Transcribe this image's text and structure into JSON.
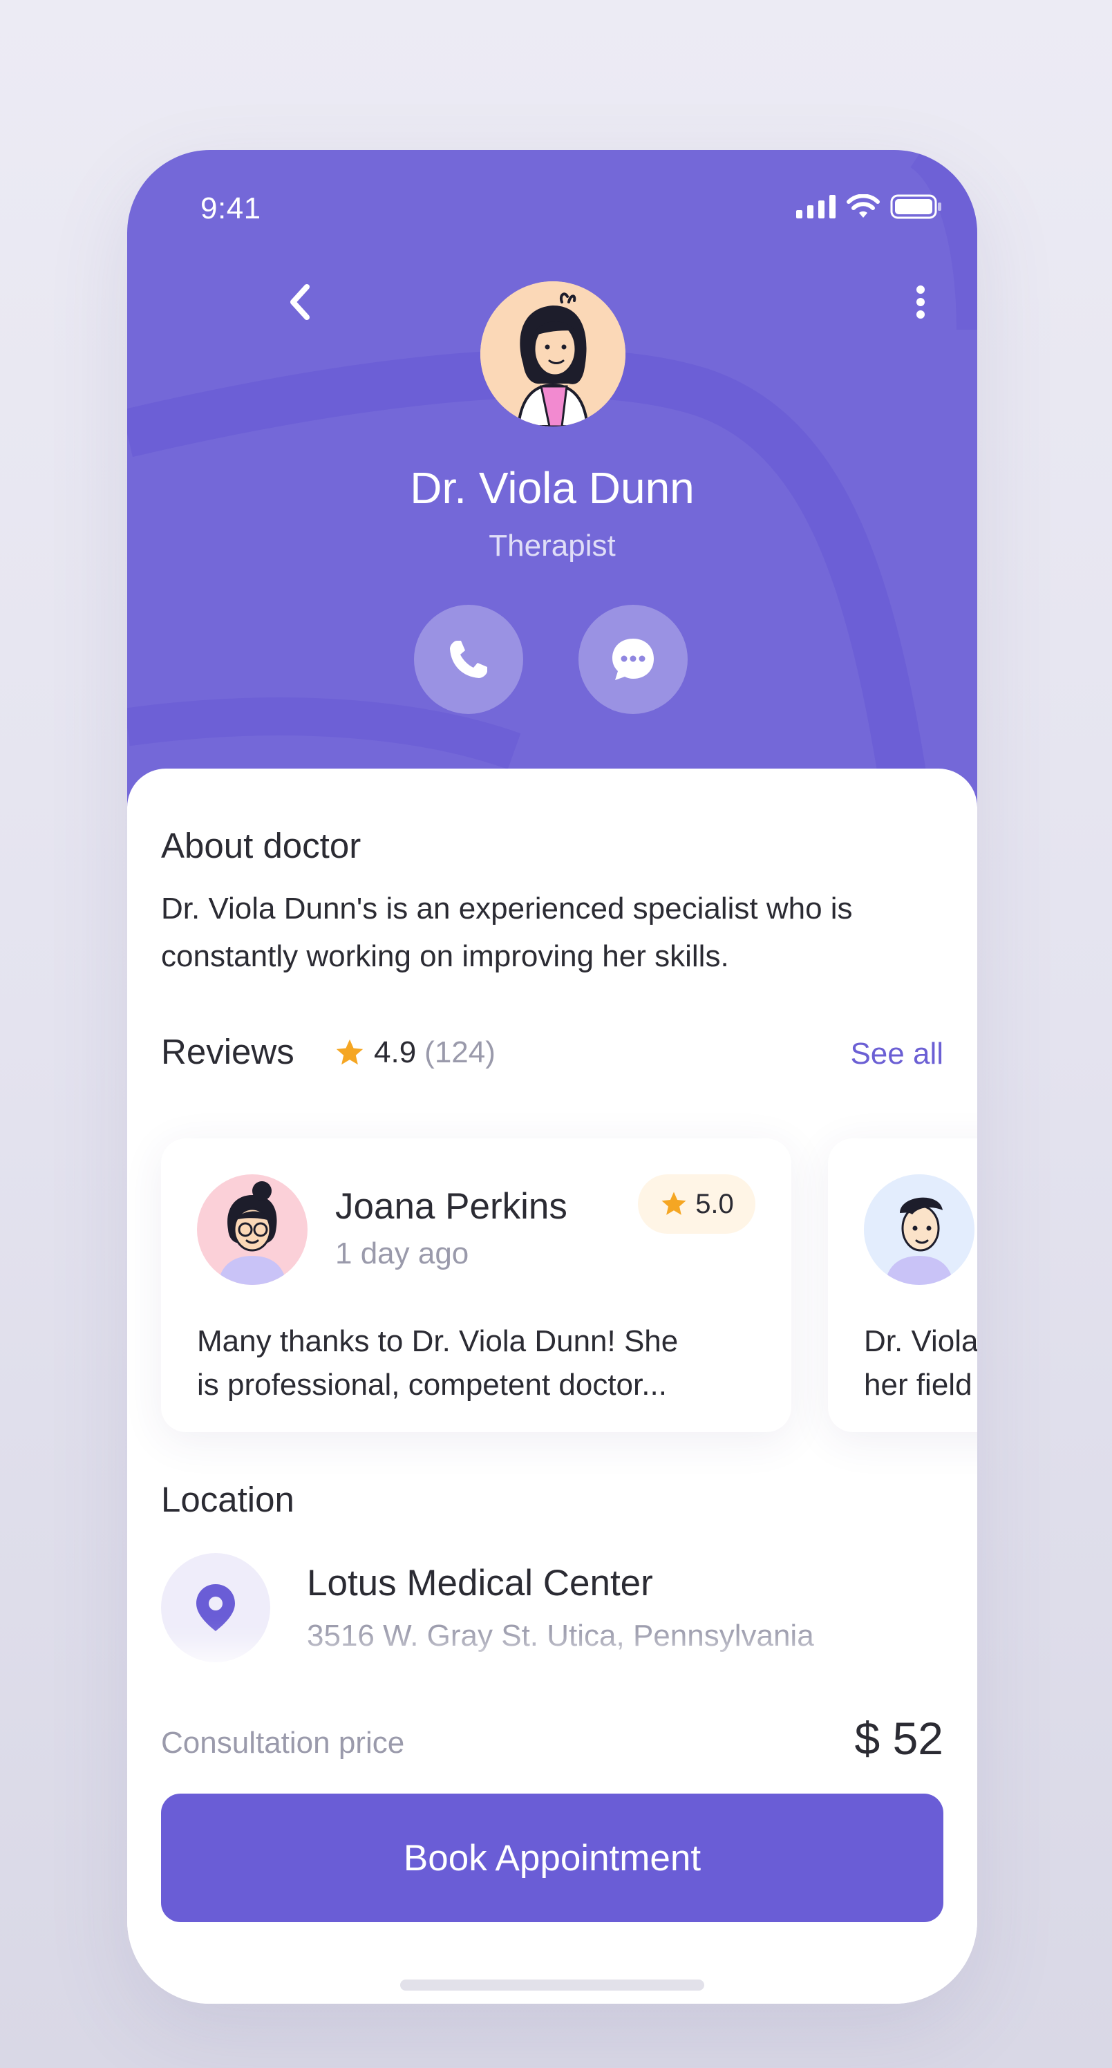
{
  "status_bar": {
    "time": "9:41"
  },
  "header": {
    "doctor_name": "Dr. Viola Dunn",
    "doctor_role": "Therapist",
    "back_icon": "chevron-left-icon",
    "menu_icon": "more-vertical-icon",
    "call_icon": "phone-icon",
    "chat_icon": "chat-bubble-icon"
  },
  "about": {
    "title": "About doctor",
    "text_line1": "Dr. Viola Dunn's is an experienced specialist who is",
    "text_line2": "constantly working on improving her skills."
  },
  "reviews": {
    "title": "Reviews",
    "rating": "4.9",
    "count": "(124)",
    "see_all": "See all",
    "items": [
      {
        "name": "Joana Perkins",
        "time": "1 day ago",
        "rating": "5.0",
        "text_line1": "Many thanks to Dr. Viola Dunn! She",
        "text_line2": "is professional, competent doctor..."
      },
      {
        "text_line1": "Dr. Viola",
        "text_line2": "her field"
      }
    ]
  },
  "location": {
    "title": "Location",
    "name": "Lotus Medical Center",
    "address": "3516 W. Gray St. Utica, Pennsylvania"
  },
  "booking": {
    "price_label": "Consultation price",
    "price_value": "$ 52",
    "button_label": "Book Appointment"
  },
  "colors": {
    "primary": "#6a5dd6",
    "header_bg": "#7468d8",
    "star": "#f5a623",
    "text": "#2b2b33",
    "muted": "#9a9aab"
  }
}
